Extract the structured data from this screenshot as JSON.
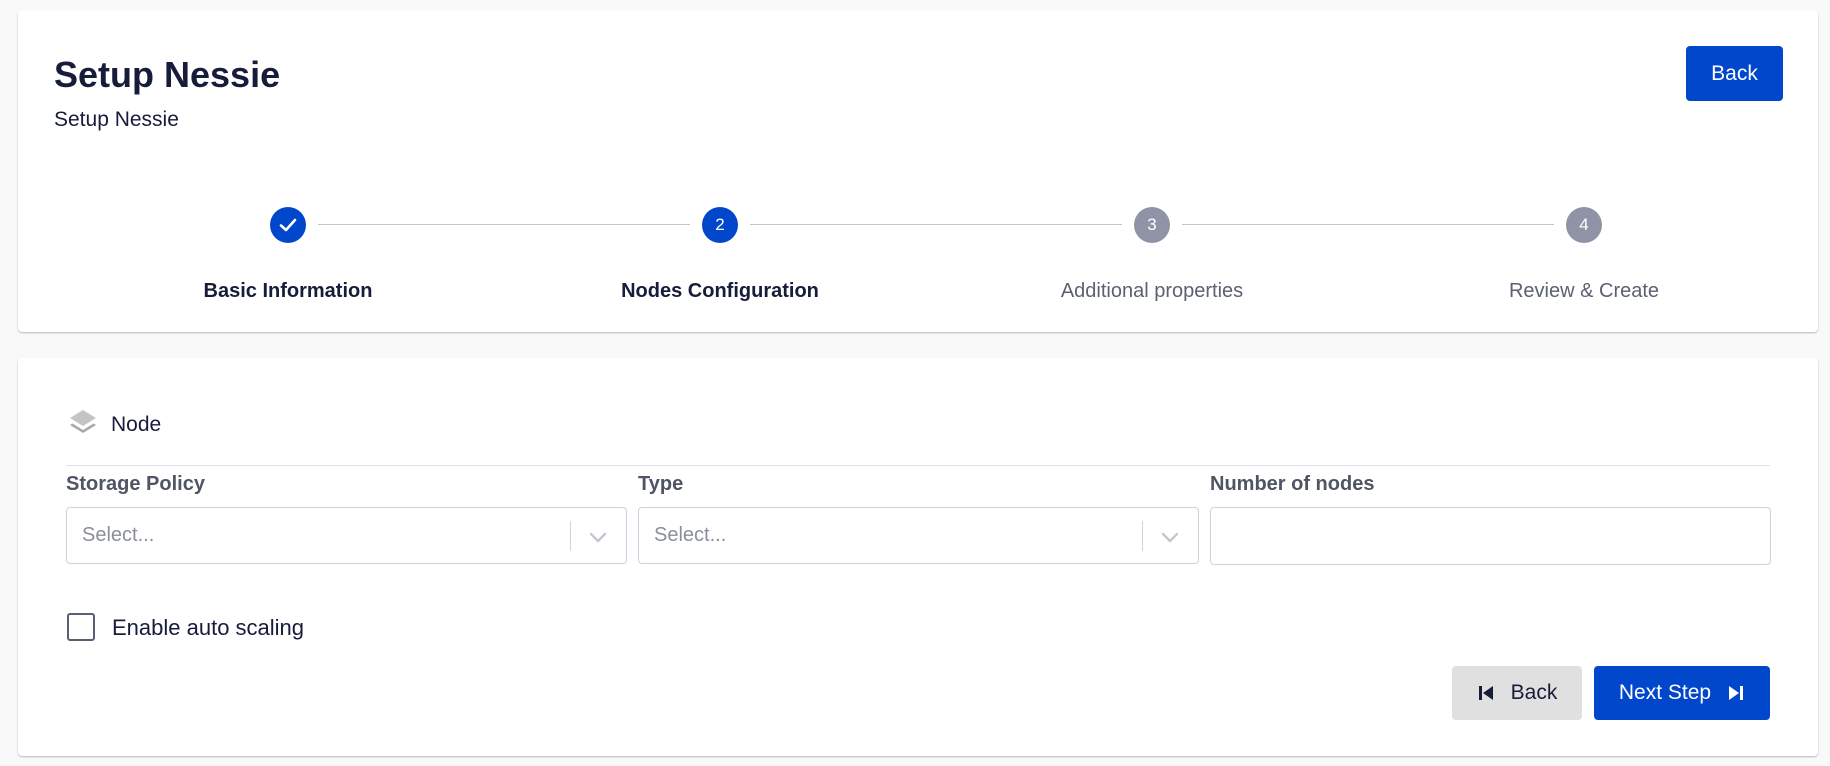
{
  "header": {
    "title": "Setup Nessie",
    "subtitle": "Setup Nessie",
    "back_label": "Back"
  },
  "stepper": {
    "steps": [
      {
        "number": "1",
        "label": "Basic Information",
        "state": "completed"
      },
      {
        "number": "2",
        "label": "Nodes Configuration",
        "state": "active"
      },
      {
        "number": "3",
        "label": "Additional properties",
        "state": "pending"
      },
      {
        "number": "4",
        "label": "Review & Create",
        "state": "pending"
      }
    ]
  },
  "node_section": {
    "title": "Node",
    "icon": "layers-icon",
    "storage_policy": {
      "label": "Storage Policy",
      "placeholder": "Select..."
    },
    "type": {
      "label": "Type",
      "placeholder": "Select..."
    },
    "number_of_nodes": {
      "label": "Number of nodes",
      "value": ""
    },
    "auto_scaling": {
      "label": "Enable auto scaling",
      "checked": false
    }
  },
  "footer": {
    "back_label": "Back",
    "next_label": "Next Step"
  },
  "colors": {
    "primary": "#0047cc",
    "pending_step": "#8f93a6",
    "text_dark": "#161c3a",
    "secondary_button": "#e0e0e0"
  }
}
